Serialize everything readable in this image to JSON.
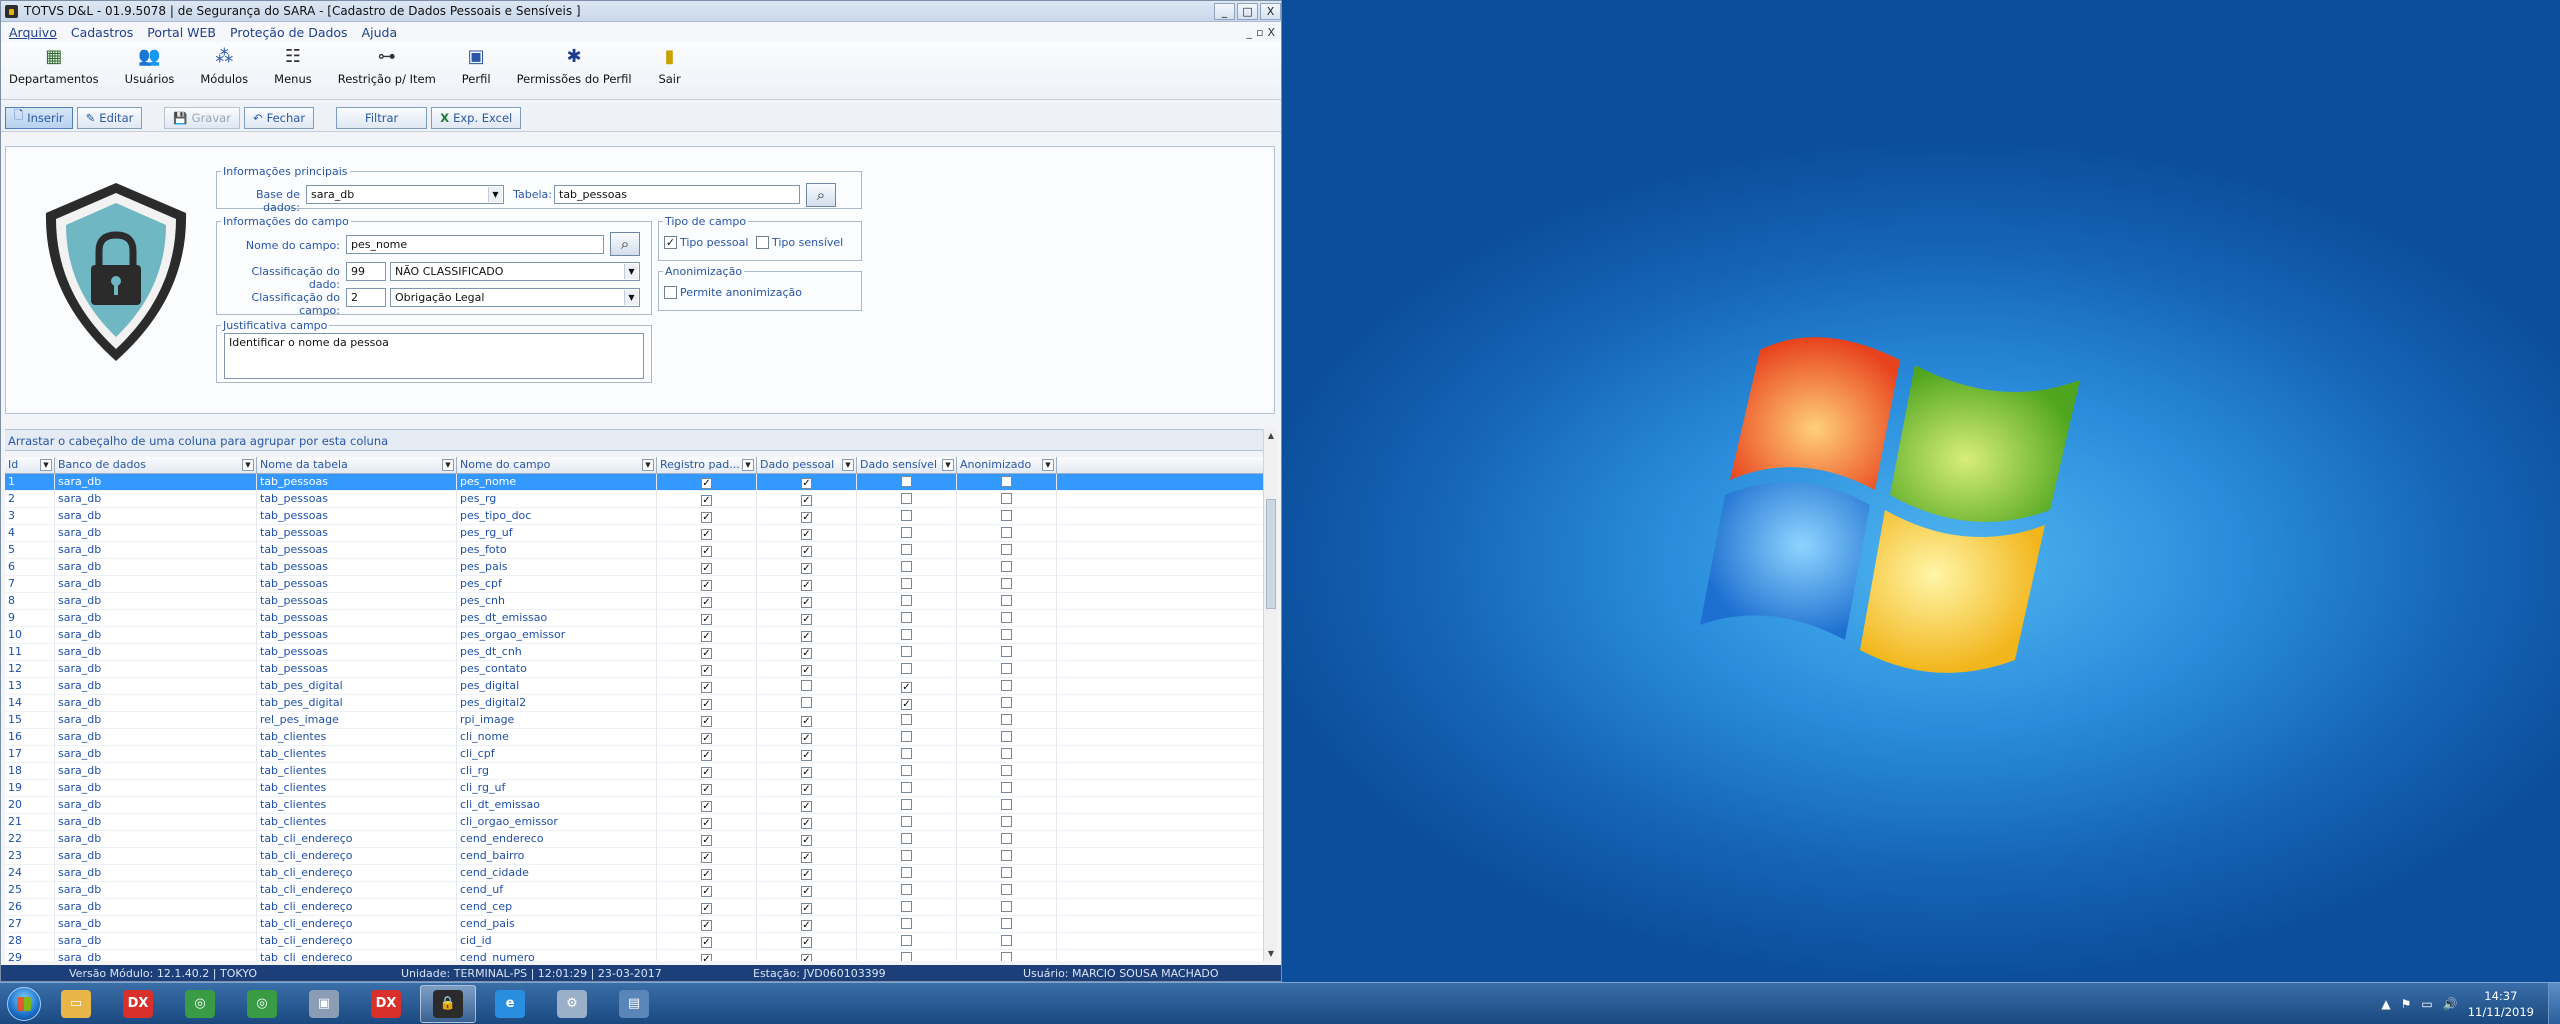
{
  "window": {
    "title": "TOTVS D&L - 01.9.5078 | de Segurança do SARA - [Cadastro de Dados Pessoais e Sensíveis ]",
    "controls": [
      "_",
      "□",
      "X"
    ],
    "inner_controls": [
      "_",
      "▫",
      "X"
    ]
  },
  "menu": [
    "Arquivo",
    "Cadastros",
    "Portal WEB",
    "Proteção de Dados",
    "Ajuda"
  ],
  "ribbon": [
    {
      "label": "Departamentos",
      "icon": "table-grid-icon"
    },
    {
      "label": "Usuários",
      "icon": "users-icon"
    },
    {
      "label": "Módulos",
      "icon": "modules-icon"
    },
    {
      "label": "Menus",
      "icon": "menu-tree-icon"
    },
    {
      "label": "Restrição p/ Item",
      "icon": "restriction-icon"
    },
    {
      "label": "Perfil",
      "icon": "profile-icon"
    },
    {
      "label": "Permissões do Perfil",
      "icon": "permissions-icon"
    },
    {
      "label": "Sair",
      "icon": "exit-door-icon"
    }
  ],
  "toolbar": {
    "inserir": "Inserir",
    "editar": "Editar",
    "gravar": "Gravar",
    "fechar": "Fechar",
    "filtrar": "Filtrar",
    "exp_excel": "Exp. Excel"
  },
  "form": {
    "info_principais": {
      "legend": "Informações principais",
      "base_label": "Base de dados:",
      "base_value": "sara_db",
      "tabela_label": "Tabela:",
      "tabela_value": "tab_pessoas"
    },
    "info_campo": {
      "legend": "Informações do campo",
      "nome_label": "Nome do campo:",
      "nome_value": "pes_nome",
      "class_dado_label": "Classificação do dado:",
      "class_dado_code": "99",
      "class_dado_value": "NÃO CLASSIFICADO",
      "class_campo_label": "Classificação do campo:",
      "class_campo_code": "2",
      "class_campo_value": "Obrigação Legal"
    },
    "tipo_campo": {
      "legend": "Tipo de campo",
      "pessoal": "Tipo pessoal",
      "pessoal_checked": true,
      "sensivel": "Tipo sensível",
      "sensivel_checked": false
    },
    "anonimizacao": {
      "legend": "Anonimização",
      "permite": "Permite anonimização",
      "checked": false
    },
    "justificativa": {
      "legend": "Justificativa campo",
      "value": "Identificar o nome da pessoa"
    }
  },
  "grid": {
    "group_hint": "Arrastar o cabeçalho de uma coluna para agrupar por esta coluna",
    "columns": [
      "Id",
      "Banco de dados",
      "Nome da tabela",
      "Nome do campo",
      "Registro pad...",
      "Dado pessoal",
      "Dado sensível",
      "Anonimizado"
    ],
    "rows": [
      [
        "1",
        "sara_db",
        "tab_pessoas",
        "pes_nome",
        true,
        true,
        false,
        false
      ],
      [
        "2",
        "sara_db",
        "tab_pessoas",
        "pes_rg",
        true,
        true,
        false,
        false
      ],
      [
        "3",
        "sara_db",
        "tab_pessoas",
        "pes_tipo_doc",
        true,
        true,
        false,
        false
      ],
      [
        "4",
        "sara_db",
        "tab_pessoas",
        "pes_rg_uf",
        true,
        true,
        false,
        false
      ],
      [
        "5",
        "sara_db",
        "tab_pessoas",
        "pes_foto",
        true,
        true,
        false,
        false
      ],
      [
        "6",
        "sara_db",
        "tab_pessoas",
        "pes_pais",
        true,
        true,
        false,
        false
      ],
      [
        "7",
        "sara_db",
        "tab_pessoas",
        "pes_cpf",
        true,
        true,
        false,
        false
      ],
      [
        "8",
        "sara_db",
        "tab_pessoas",
        "pes_cnh",
        true,
        true,
        false,
        false
      ],
      [
        "9",
        "sara_db",
        "tab_pessoas",
        "pes_dt_emissao",
        true,
        true,
        false,
        false
      ],
      [
        "10",
        "sara_db",
        "tab_pessoas",
        "pes_orgao_emissor",
        true,
        true,
        false,
        false
      ],
      [
        "11",
        "sara_db",
        "tab_pessoas",
        "pes_dt_cnh",
        true,
        true,
        false,
        false
      ],
      [
        "12",
        "sara_db",
        "tab_pessoas",
        "pes_contato",
        true,
        true,
        false,
        false
      ],
      [
        "13",
        "sara_db",
        "tab_pes_digital",
        "pes_digital",
        true,
        false,
        true,
        false
      ],
      [
        "14",
        "sara_db",
        "tab_pes_digital",
        "pes_digital2",
        true,
        false,
        true,
        false
      ],
      [
        "15",
        "sara_db",
        "rel_pes_image",
        "rpi_image",
        true,
        true,
        false,
        false
      ],
      [
        "16",
        "sara_db",
        "tab_clientes",
        "cli_nome",
        true,
        true,
        false,
        false
      ],
      [
        "17",
        "sara_db",
        "tab_clientes",
        "cli_cpf",
        true,
        true,
        false,
        false
      ],
      [
        "18",
        "sara_db",
        "tab_clientes",
        "cli_rg",
        true,
        true,
        false,
        false
      ],
      [
        "19",
        "sara_db",
        "tab_clientes",
        "cli_rg_uf",
        true,
        true,
        false,
        false
      ],
      [
        "20",
        "sara_db",
        "tab_clientes",
        "cli_dt_emissao",
        true,
        true,
        false,
        false
      ],
      [
        "21",
        "sara_db",
        "tab_clientes",
        "cli_orgao_emissor",
        true,
        true,
        false,
        false
      ],
      [
        "22",
        "sara_db",
        "tab_cli_endereço",
        "cend_endereco",
        true,
        true,
        false,
        false
      ],
      [
        "23",
        "sara_db",
        "tab_cli_endereço",
        "cend_bairro",
        true,
        true,
        false,
        false
      ],
      [
        "24",
        "sara_db",
        "tab_cli_endereço",
        "cend_cidade",
        true,
        true,
        false,
        false
      ],
      [
        "25",
        "sara_db",
        "tab_cli_endereço",
        "cend_uf",
        true,
        true,
        false,
        false
      ],
      [
        "26",
        "sara_db",
        "tab_cli_endereço",
        "cend_cep",
        true,
        true,
        false,
        false
      ],
      [
        "27",
        "sara_db",
        "tab_cli_endereço",
        "cend_pais",
        true,
        true,
        false,
        false
      ],
      [
        "28",
        "sara_db",
        "tab_cli_endereço",
        "cid_id",
        true,
        true,
        false,
        false
      ],
      [
        "29",
        "sara_db",
        "tab_cli_endereço",
        "cend_numero",
        true,
        true,
        false,
        false
      ]
    ]
  },
  "status": {
    "versao": "Versão Módulo:   12.1.40.2  |  TOKYO",
    "unidade": "Unidade:  TERMINAL-PS | 12:01:29 | 23-03-2017",
    "estacao": "Estação: JVD060103399",
    "usuario": "Usuário: MARCIO SOUSA MACHADO"
  },
  "taskbar": {
    "time": "14:37",
    "date": "11/11/2019",
    "apps": [
      {
        "name": "explorer",
        "color": "#e7b548",
        "glyph": "▭"
      },
      {
        "name": "dx",
        "color": "#d9302c",
        "glyph": "DX"
      },
      {
        "name": "chrome",
        "color": "#3a9b45",
        "glyph": "◎"
      },
      {
        "name": "chrome-2",
        "color": "#3a9b45",
        "glyph": "◎"
      },
      {
        "name": "app-window",
        "color": "#8a9db5",
        "glyph": "▣"
      },
      {
        "name": "dx-2",
        "color": "#d9302c",
        "glyph": "DX"
      },
      {
        "name": "lock-app",
        "color": "#2b2b2b",
        "glyph": "🔒"
      },
      {
        "name": "internet-explorer",
        "color": "#2a8ee0",
        "glyph": "e"
      },
      {
        "name": "tool",
        "color": "#9ab0c8",
        "glyph": "⚙"
      },
      {
        "name": "remote-desktop",
        "color": "#5a85b8",
        "glyph": "▤"
      }
    ],
    "active_index": 6
  }
}
